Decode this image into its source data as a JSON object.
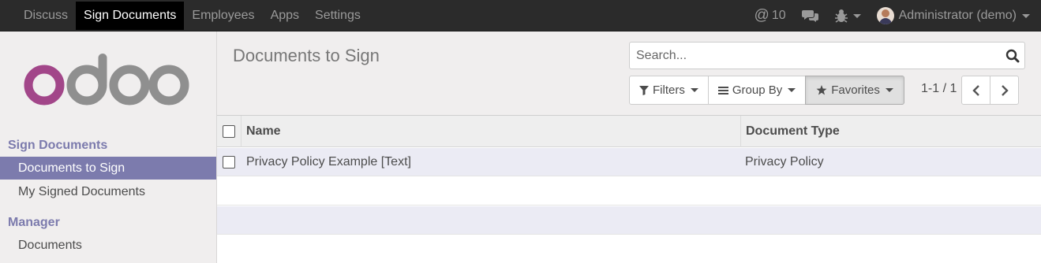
{
  "topbar": {
    "menu": [
      "Discuss",
      "Sign Documents",
      "Employees",
      "Apps",
      "Settings"
    ],
    "active_menu": "Sign Documents",
    "mentions_count": "10",
    "user_name": "Administrator (demo)"
  },
  "sidebar": {
    "logo_text": "odoo",
    "section_sign": "Sign Documents",
    "item_to_sign": "Documents to Sign",
    "item_signed": "My Signed Documents",
    "section_manager": "Manager",
    "item_documents": "Documents"
  },
  "control_panel": {
    "breadcrumb": "Documents to Sign",
    "search_placeholder": "Search...",
    "filters_label": "Filters",
    "groupby_label": "Group By",
    "favorites_label": "Favorites",
    "pager": "1-1 / 1"
  },
  "table": {
    "columns": [
      "Name",
      "Document Type"
    ],
    "rows": [
      {
        "name": "Privacy Policy Example [Text]",
        "type": "Privacy Policy"
      }
    ]
  },
  "colors": {
    "accent": "#7c7bad",
    "topbar": "#2b2b2b",
    "logo_purple": "#a24689",
    "logo_gray": "#8f8f8f"
  }
}
